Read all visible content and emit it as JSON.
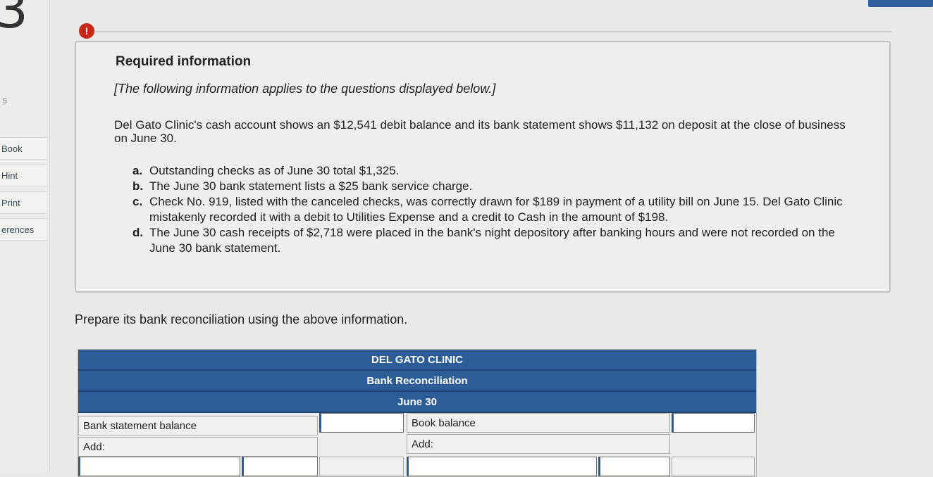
{
  "sidebar": {
    "qnum": "3",
    "mark": "5",
    "items": [
      "Book",
      "Hint",
      "Print",
      "erences"
    ]
  },
  "alert": "!",
  "info": {
    "title": "Required information",
    "note": "[The following information applies to the questions displayed below.]",
    "body": "Del Gato Clinic's cash account shows an $12,541 debit balance and its bank statement shows $11,132 on deposit at the close of business on June 30.",
    "items": [
      {
        "label": "a.",
        "text": "Outstanding checks as of June 30 total $1,325."
      },
      {
        "label": "b.",
        "text": "The June 30 bank statement lists a $25 bank service charge."
      },
      {
        "label": "c.",
        "text": "Check No. 919, listed with the canceled checks, was correctly drawn for $189 in payment of a utility bill on June 15. Del Gato Clinic mistakenly recorded it with a debit to Utilities Expense and a credit to Cash in the amount of $198."
      },
      {
        "label": "d.",
        "text": "The June 30 cash receipts of $2,718 were placed in the bank's night depository after banking hours and were not recorded on the June 30 bank statement."
      }
    ]
  },
  "prepare": "Prepare its bank reconciliation using the above information.",
  "reconciliation": {
    "company": "DEL GATO CLINIC",
    "title": "Bank Reconciliation",
    "date": "June 30",
    "bank_label": "Bank statement balance",
    "bank_add": "Add:",
    "book_label": "Book balance",
    "book_add": "Add:"
  },
  "colors": {
    "header": "#2c5d96",
    "alert": "#c9271a"
  }
}
